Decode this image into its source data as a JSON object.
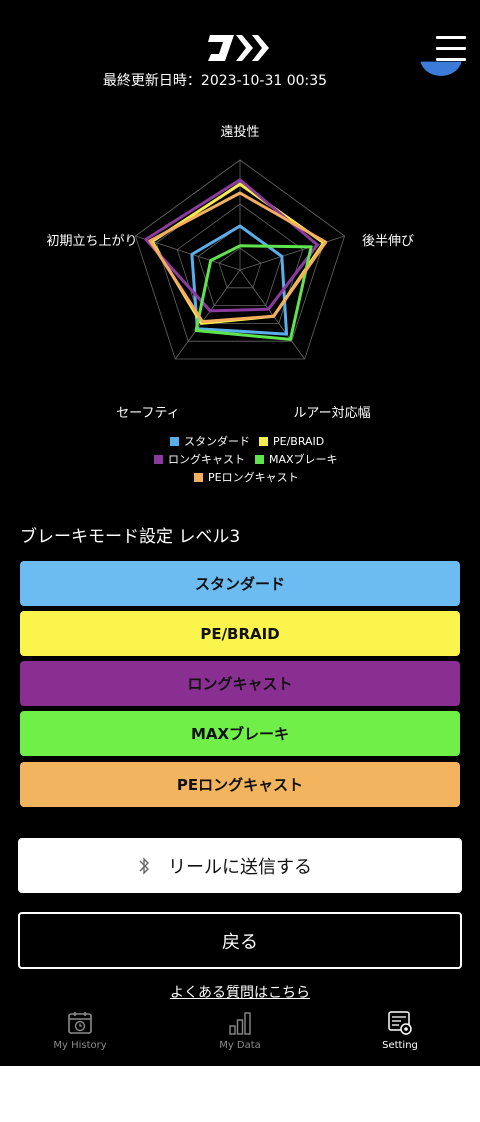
{
  "header": {
    "updated_label": "最終更新日時：",
    "updated_value": "2023-10-31 00:35"
  },
  "chart_data": {
    "type": "radar",
    "axes": [
      "遠投性",
      "後半伸び",
      "ルアー対応幅",
      "セーフティ",
      "初期立ち上がり"
    ],
    "rlim": [
      0,
      5
    ],
    "grid": true,
    "legend_placement": "bottom",
    "series": [
      {
        "name": "スタンダード",
        "color": "#5aafea",
        "values": [
          2.0,
          2.0,
          3.6,
          3.3,
          2.3
        ]
      },
      {
        "name": "PE/BRAID",
        "color": "#f5ee4a",
        "values": [
          3.9,
          4.0,
          2.6,
          3.0,
          4.2
        ]
      },
      {
        "name": "ロングキャスト",
        "color": "#8b3b9e",
        "values": [
          4.1,
          3.7,
          2.2,
          2.3,
          4.5
        ]
      },
      {
        "name": "MAXブレーキ",
        "color": "#5fe34e",
        "values": [
          1.1,
          3.4,
          3.9,
          3.4,
          1.4
        ]
      },
      {
        "name": "PEロングキャスト",
        "color": "#f4ae5f",
        "values": [
          3.5,
          4.1,
          2.6,
          2.9,
          4.3
        ]
      }
    ]
  },
  "mode": {
    "title": "ブレーキモード設定 レベル3",
    "buttons": [
      {
        "label": "スタンダード",
        "color": "#6cbcf2"
      },
      {
        "label": "PE/BRAID",
        "color": "#fbf44c"
      },
      {
        "label": "ロングキャスト",
        "color": "#8a2f92"
      },
      {
        "label": "MAXブレーキ",
        "color": "#70ef48"
      },
      {
        "label": "PEロングキャスト",
        "color": "#f3b45f"
      }
    ]
  },
  "actions": {
    "send_label": "リールに送信する",
    "back_label": "戻る",
    "faq_label": "よくある質問はこちら"
  },
  "nav": {
    "items": [
      {
        "label": "My History",
        "icon": "calendar-history-icon"
      },
      {
        "label": "My Data",
        "icon": "bar-chart-icon"
      },
      {
        "label": "Setting",
        "icon": "settings-icon"
      }
    ],
    "active": "Setting"
  }
}
